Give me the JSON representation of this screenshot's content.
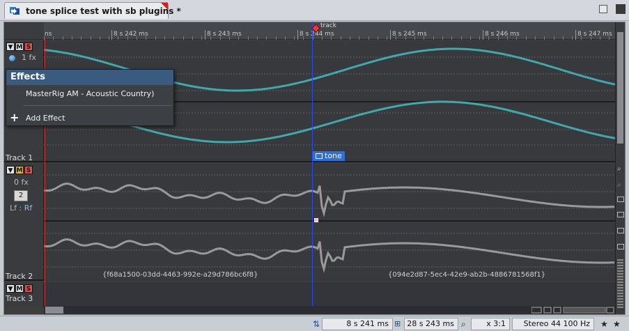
{
  "window": {
    "title": "tone splice test with sb plugins *"
  },
  "ruler": {
    "labels": [
      "ns",
      "8 s 242 ms",
      "8 s 243 ms",
      "8 s 244 ms",
      "8 s 245 ms",
      "8 s 246 ms",
      "8 s 247 ms"
    ],
    "marker_label": "track"
  },
  "tracks": [
    {
      "name": "Track 1",
      "fx": "1 fx",
      "clip_label": "tone"
    },
    {
      "name": "Track 2",
      "fx": "0 fx",
      "channel": "2",
      "channel_mode": "Lf : Rf",
      "clip_ids": [
        "{f68a1500-03dd-4463-992e-a29d786bc6f8}",
        "{094e2d87-5ec4-42e9-ab2b-4886781568f1}"
      ]
    },
    {
      "name": "Track 3"
    }
  ],
  "track_buttons": {
    "mute": "M",
    "solo": "S"
  },
  "effects_popup": {
    "header": "Effects",
    "item": "MasterRig AM - Acoustic Country)",
    "add": "Add Effect"
  },
  "status": {
    "cursor_time": "8 s 241 ms",
    "selection_time": "28 s 243 ms",
    "zoom": "x 3:1",
    "format": "Stereo 44 100 Hz"
  },
  "colors": {
    "wave_track1": "#3fa9ad",
    "wave_track2": "#9a9a9a",
    "cursor": "#2a4be8",
    "clip_tag": "#2f6fd8"
  }
}
